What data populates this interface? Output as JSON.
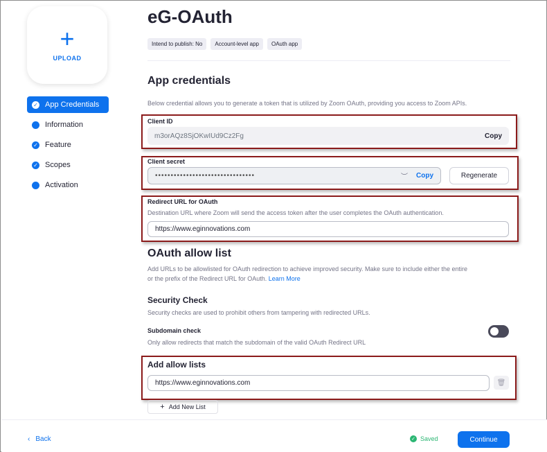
{
  "sidebar": {
    "upload_label": "UPLOAD",
    "items": [
      {
        "label": "App Credentials",
        "icon": "check-icon"
      },
      {
        "label": "Information",
        "icon": "dot-icon"
      },
      {
        "label": "Feature",
        "icon": "check-icon"
      },
      {
        "label": "Scopes",
        "icon": "check-icon"
      },
      {
        "label": "Activation",
        "icon": "dot-icon"
      }
    ]
  },
  "header": {
    "title": "eG-OAuth",
    "tags": [
      "Intend to publish: No",
      "Account-level app",
      "OAuth app"
    ]
  },
  "credentials": {
    "heading": "App credentials",
    "description": "Below credential allows you to generate a token that is utilized by Zoom OAuth, providing you access to Zoom APIs.",
    "client_id_label": "Client ID",
    "client_id_value": "m3orAQz8SjOKwIUd9Cz2Fg",
    "copy_label": "Copy",
    "client_secret_label": "Client secret",
    "client_secret_value": "••••••••••••••••••••••••••••••••",
    "secret_copy_label": "Copy",
    "regenerate_label": "Regenerate",
    "redirect_label": "Redirect URL for OAuth",
    "redirect_desc": "Destination URL where Zoom will send the access token after the user completes the OAuth authentication.",
    "redirect_value": "https://www.eginnovations.com"
  },
  "allowlist": {
    "heading": "OAuth allow list",
    "desc_line1": "Add URLs to be allowlisted for OAuth redirection to achieve improved security. Make sure to include either the entire",
    "desc_line2": "or the prefix of the Redirect URL for OAuth.",
    "learn_more": "Learn More",
    "security_heading": "Security Check",
    "security_desc": "Security checks are used to prohibit others from tampering with redirected URLs.",
    "subdomain_label": "Subdomain check",
    "subdomain_desc": "Only allow redirects that match the subdomain of the valid OAuth Redirect URL",
    "add_lists_heading": "Add allow lists",
    "allow_value": "https://www.eginnovations.com",
    "add_new_label": "Add New List"
  },
  "footer": {
    "back_label": "Back",
    "saved_label": "Saved",
    "continue_label": "Continue"
  },
  "colors": {
    "accent": "#0e72ed",
    "highlight": "#8b1a1a",
    "saved": "#2bb673"
  }
}
